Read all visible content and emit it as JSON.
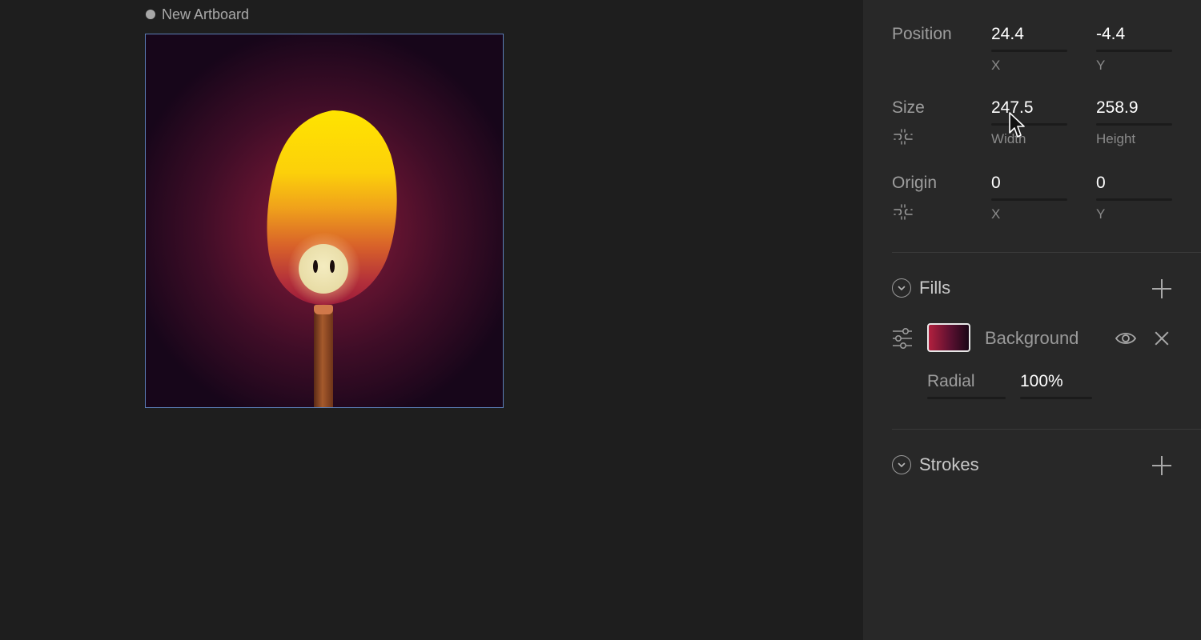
{
  "artboard": {
    "name": "New Artboard"
  },
  "inspector": {
    "position": {
      "label": "Position",
      "x": "24.4",
      "y": "-4.4",
      "x_label": "X",
      "y_label": "Y"
    },
    "size": {
      "label": "Size",
      "width": "247.5",
      "height": "258.9",
      "width_label": "Width",
      "height_label": "Height"
    },
    "origin": {
      "label": "Origin",
      "x": "0",
      "y": "0",
      "x_label": "X",
      "y_label": "Y"
    },
    "fills": {
      "title": "Fills",
      "items": [
        {
          "name": "Background",
          "type": "Radial",
          "opacity": "100%",
          "swatch_colors": [
            "#b2203e",
            "#1a0616"
          ]
        }
      ]
    },
    "strokes": {
      "title": "Strokes"
    }
  },
  "icons": {
    "fills_toggle": "chevron-down-icon",
    "strokes_toggle": "chevron-down-icon",
    "add_fill": "plus-icon",
    "add_stroke": "plus-icon",
    "fill_settings": "sliders-icon",
    "fill_visibility": "eye-icon",
    "fill_remove": "close-icon",
    "aspect_lock": "unlink-icon"
  },
  "colors": {
    "canvas_bg": "#1e1e1e",
    "panel_bg": "#282828",
    "selection_border": "#5b7fb8",
    "flame_top": "#ffd800",
    "flame_bottom": "#a51f37"
  }
}
